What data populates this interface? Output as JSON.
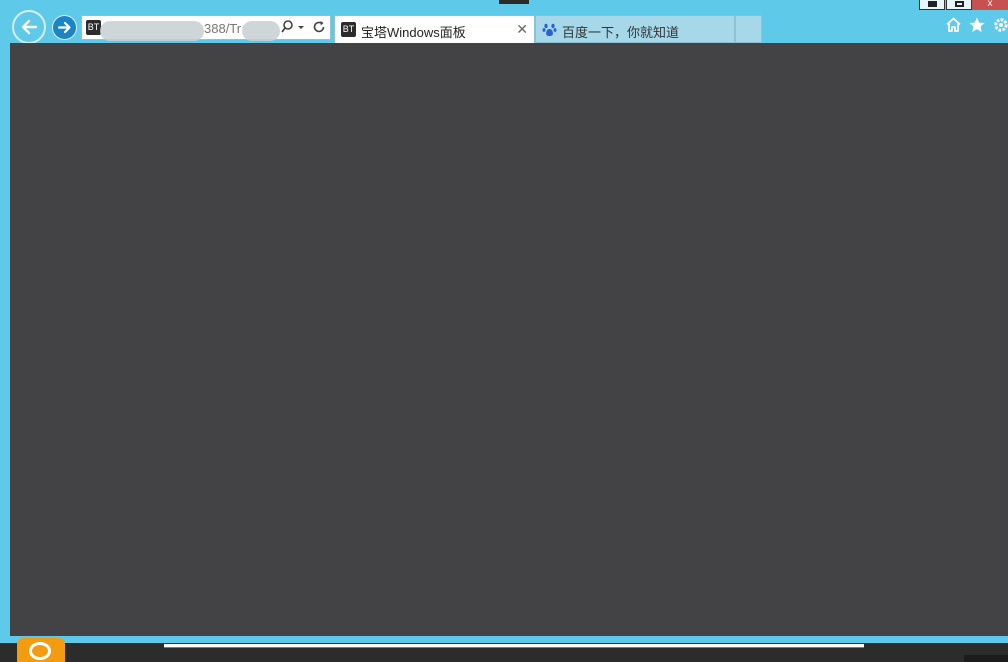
{
  "window": {
    "close_label": "x"
  },
  "address_bar": {
    "favicon_text": "BT",
    "url_visible": "388/Tr"
  },
  "tabs": [
    {
      "label": "宝塔Windows面板",
      "favicon_text": "BT",
      "active": true
    },
    {
      "label": "百度一下，你就知道",
      "active": false
    }
  ],
  "colors": {
    "chrome": "#5fc9ea",
    "content": "#434345",
    "accent": "#1b84c6"
  },
  "icons": {
    "back": "back-arrow-icon",
    "forward": "forward-arrow-icon",
    "search": "search-icon",
    "dropdown": "chevron-down-icon",
    "refresh": "refresh-icon",
    "home": "home-icon",
    "favorites": "star-icon",
    "tools": "gear-icon"
  }
}
